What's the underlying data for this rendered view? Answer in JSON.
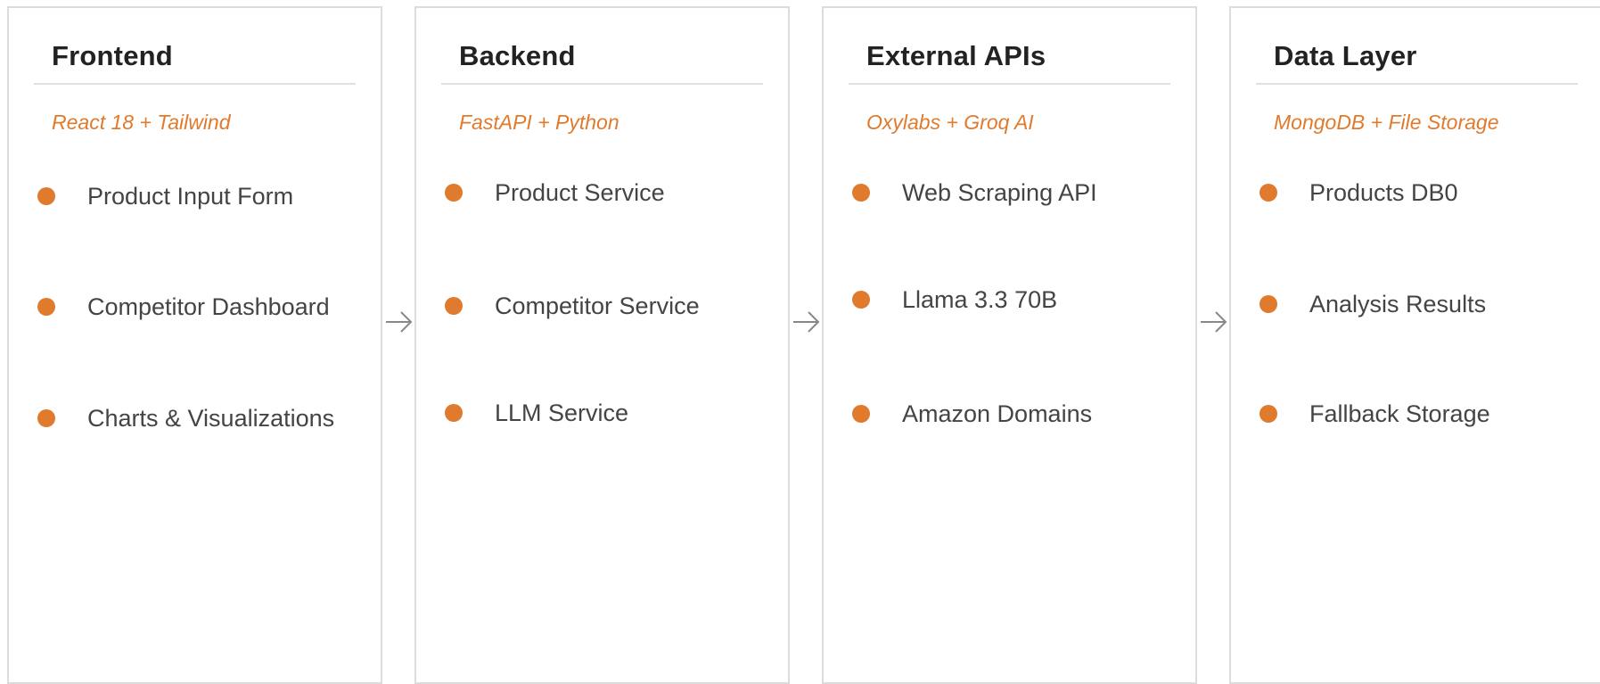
{
  "columns": [
    {
      "title": "Frontend",
      "subtitle": "React 18 + Tailwind",
      "items": [
        "Product Input Form",
        "Competitor Dashboard",
        "Charts & Visualizations"
      ]
    },
    {
      "title": "Backend",
      "subtitle": "FastAPI + Python",
      "items": [
        "Product Service",
        "Competitor Service",
        "LLM Service"
      ]
    },
    {
      "title": "External APIs",
      "subtitle": "Oxylabs + Groq AI",
      "items": [
        "Web Scraping API",
        "Llama 3.3 70B",
        "Amazon Domains"
      ]
    },
    {
      "title": "Data Layer",
      "subtitle": "MongoDB + File Storage",
      "items": [
        "Products DB0",
        "Analysis Results",
        "Fallback Storage"
      ]
    }
  ],
  "colors": {
    "accent": "#e07b2e",
    "border": "#dcdcdc",
    "title": "#222222",
    "text": "#444444",
    "arrow": "#888888"
  },
  "icons": {
    "bullet": "filled-circle",
    "connector": "right-arrow"
  }
}
